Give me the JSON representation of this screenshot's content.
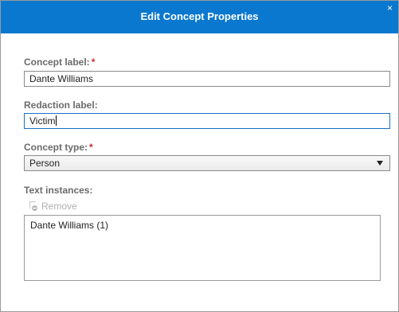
{
  "dialog": {
    "title": "Edit Concept Properties",
    "close_glyph": "×"
  },
  "concept_label": {
    "label": "Concept label:",
    "required_mark": "*",
    "value": "Dante Williams"
  },
  "redaction_label": {
    "label": "Redaction label:",
    "value": "Victim"
  },
  "concept_type": {
    "label": "Concept type:",
    "required_mark": "*",
    "selected": "Person"
  },
  "text_instances": {
    "label": "Text instances:",
    "remove_label": "Remove",
    "items": [
      "Dante Williams (1)"
    ]
  },
  "colors": {
    "titlebar": "#0a78cf",
    "required": "#c1272d",
    "label": "#6b6b6b"
  },
  "icons": {
    "close": "close-icon",
    "dropdown": "chevron-down-icon",
    "remove": "remove-icon"
  }
}
